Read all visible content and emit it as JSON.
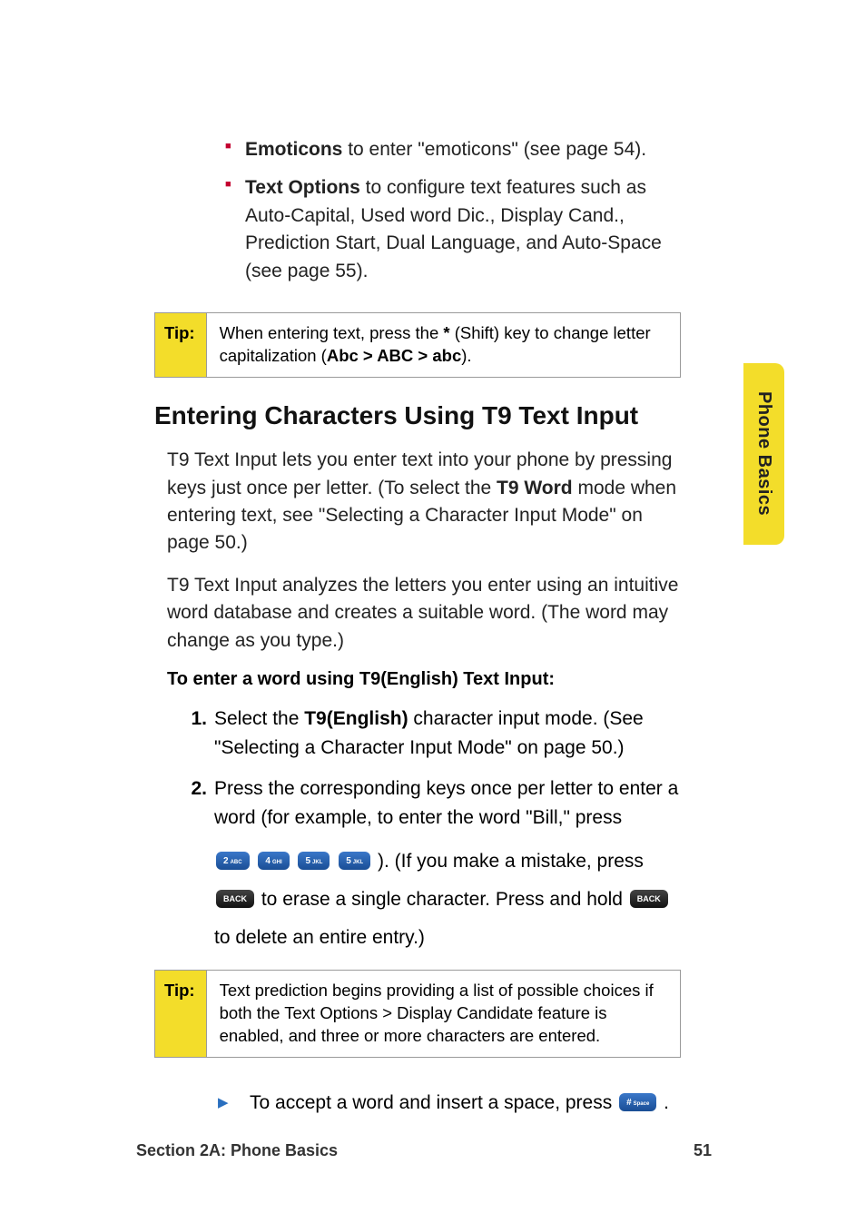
{
  "sideTab": "Phone Basics",
  "bullets": [
    {
      "bold": "Emoticons",
      "rest": " to enter \"emoticons\" (see page 54)."
    },
    {
      "bold": "Text Options",
      "rest": " to configure text features such as Auto-Capital, Used word Dic., Display Cand., Prediction Start, Dual Language, and Auto-Space (see page 55)."
    }
  ],
  "tip1": {
    "label": "Tip:",
    "pre": "When entering text, press the ",
    "star": "*",
    "mid": " (Shift) key to change letter capitalization (",
    "seq": "Abc > ABC > abc",
    "post": ")."
  },
  "heading": "Entering Characters Using T9 Text Input",
  "para1": {
    "a": "T9 Text Input lets you enter text into your phone by pressing keys just once per letter. (To select the ",
    "b": "T9 Word",
    "c": " mode when entering text, see \"Selecting a Character Input Mode\" on page 50.)"
  },
  "para2": "T9 Text Input analyzes the letters you enter using an intuitive word database and creates a suitable word. (The word may change as you type.)",
  "subheading": "To enter a word using T9(English) Text Input:",
  "step1": {
    "a": "Select the ",
    "b": "T9(English)",
    "c": " character input mode. (See \"Selecting a Character Input Mode\" on page 50.)"
  },
  "step2": {
    "intro": "Press the corresponding keys once per letter to enter a word (for example, to enter the word \"Bill,\" press",
    "mid": "). (If you make a mistake, press ",
    "aftermid": "to erase a single character. Press and hold ",
    "tail": " to delete an entire entry.)"
  },
  "keys": {
    "k2": {
      "num": "2",
      "sub": "ABC"
    },
    "k4": {
      "num": "4",
      "sub": "GHI"
    },
    "k5a": {
      "num": "5",
      "sub": "JKL"
    },
    "k5b": {
      "num": "5",
      "sub": "JKL"
    },
    "back": "BACK",
    "hash": {
      "num": "#",
      "sub": "Space"
    }
  },
  "tip2": {
    "label": "Tip:",
    "text": "Text prediction begins providing a list of possible choices if both the Text Options > Display Candidate feature is enabled, and three or more characters are entered."
  },
  "arrowItem": {
    "pre": "To accept a word and insert a space, press ",
    "post": "."
  },
  "footer": {
    "left": "Section 2A: Phone Basics",
    "right": "51"
  }
}
